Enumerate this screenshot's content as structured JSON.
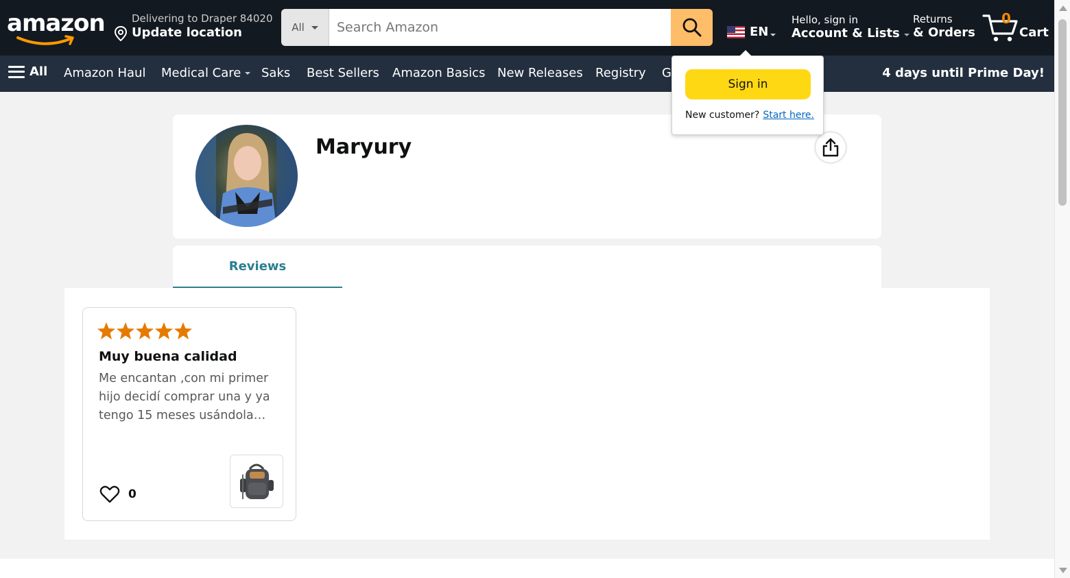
{
  "header": {
    "logo": "amazon",
    "delivery_line1": "Delivering to Draper 84020",
    "delivery_line2": "Update location",
    "search_category": "All",
    "search_placeholder": "Search Amazon",
    "language": "EN",
    "account_line1": "Hello, sign in",
    "account_line2": "Account & Lists",
    "orders_line1": "Returns",
    "orders_line2": "& Orders",
    "cart_count": "0",
    "cart_label": "Cart"
  },
  "subnav": {
    "all": "All",
    "items": [
      "Amazon Haul",
      "Medical Care",
      "Saks",
      "Best Sellers",
      "Amazon Basics",
      "New Releases",
      "Registry",
      "G"
    ],
    "prime_banner": "4 days until Prime Day!"
  },
  "signin_popover": {
    "button": "Sign in",
    "new_customer": "New customer?",
    "start_link": "Start here."
  },
  "profile": {
    "name": "Maryury"
  },
  "tabs": {
    "reviews": "Reviews"
  },
  "review": {
    "rating": 5,
    "title": "Muy buena calidad",
    "body": "Me encantan ,con mi primer hijo decidí comprar una y ya tengo 15 meses usándola…",
    "likes": "0"
  },
  "colors": {
    "nav_bg": "#131921",
    "subnav_bg": "#232f3e",
    "search_button": "#febd69",
    "signin_button": "#ffd814",
    "star": "#e67a00",
    "accent_teal": "#2a7f8f",
    "cart_count": "#f08804"
  },
  "icons": [
    "location-pin-icon",
    "search-icon",
    "us-flag-icon",
    "cart-icon",
    "hamburger-icon",
    "share-icon",
    "heart-icon",
    "star-icon"
  ]
}
